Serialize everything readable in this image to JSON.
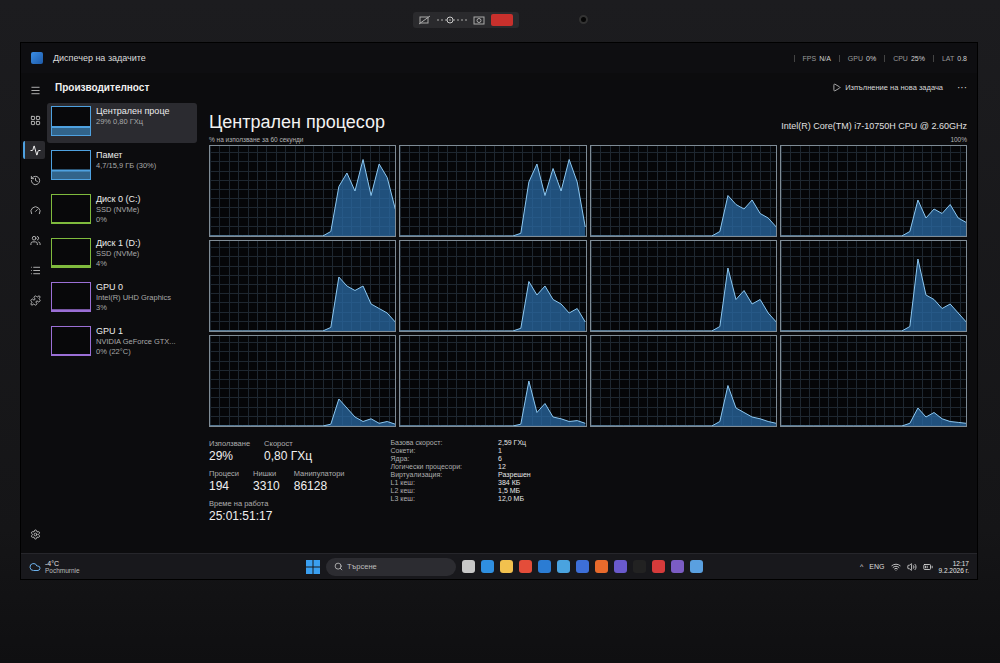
{
  "window": {
    "title": "Диспечер на задачите",
    "overlay": [
      {
        "label": "FPS",
        "value": "N/A"
      },
      {
        "label": "GPU",
        "value": "0%"
      },
      {
        "label": "CPU",
        "value": "25%"
      },
      {
        "label": "LAT",
        "value": "0.8"
      }
    ]
  },
  "nav": [
    {
      "selected": false
    },
    {
      "selected": false
    },
    {
      "selected": true
    },
    {
      "selected": false
    },
    {
      "selected": false
    },
    {
      "selected": false
    },
    {
      "selected": false
    },
    {
      "selected": false
    },
    {
      "selected": false
    }
  ],
  "header": {
    "title": "Производителност",
    "action": "Изпълнение на нова задача",
    "more": "···"
  },
  "sidebar": {
    "items": [
      {
        "name": "Централен проце",
        "lines": [
          "29% 0,80 ГХц"
        ],
        "level": 0.29,
        "color": "#4ea1e0",
        "selected": true
      },
      {
        "name": "Памет",
        "lines": [
          "4,7/15,9 ГБ (30%)"
        ],
        "level": 0.3,
        "color": "#4ea1e0",
        "selected": false
      },
      {
        "name": "Диск 0 (C:)",
        "lines": [
          "SSD (NVMe)",
          "0%"
        ],
        "level": 0.0,
        "color": "#7fba3d",
        "selected": false
      },
      {
        "name": "Диск 1 (D:)",
        "lines": [
          "SSD (NVMe)",
          "4%"
        ],
        "level": 0.04,
        "color": "#7fba3d",
        "selected": false
      },
      {
        "name": "GPU 0",
        "lines": [
          "Intel(R) UHD Graphics",
          "3%"
        ],
        "level": 0.03,
        "color": "#9b6fd6",
        "selected": false
      },
      {
        "name": "GPU 1",
        "lines": [
          "NVIDIA GeForce GTX...",
          "0% (22°C)"
        ],
        "level": 0.0,
        "color": "#9b6fd6",
        "selected": false
      }
    ]
  },
  "cpu": {
    "title": "Централен процесор",
    "model": "Intel(R) Core(TM) i7-10750H CPU @ 2.60GHz",
    "chart": {
      "caption": "% на използване за 60 секунди",
      "max": "100%",
      "series": [
        {
          "values": [
            0,
            0,
            0,
            0,
            0,
            0,
            0,
            0,
            0,
            0,
            0,
            0,
            0,
            0,
            0,
            5,
            55,
            70,
            50,
            85,
            45,
            80,
            65,
            30
          ]
        },
        {
          "values": [
            0,
            0,
            0,
            0,
            0,
            0,
            0,
            0,
            0,
            0,
            0,
            0,
            0,
            0,
            0,
            3,
            60,
            80,
            45,
            75,
            50,
            85,
            60,
            10
          ]
        },
        {
          "values": [
            0,
            0,
            0,
            0,
            0,
            0,
            0,
            0,
            0,
            0,
            0,
            0,
            0,
            0,
            0,
            0,
            5,
            45,
            35,
            30,
            40,
            25,
            20,
            10
          ]
        },
        {
          "values": [
            0,
            0,
            0,
            0,
            0,
            0,
            0,
            0,
            0,
            0,
            0,
            0,
            0,
            0,
            0,
            0,
            5,
            40,
            20,
            30,
            25,
            35,
            20,
            15
          ]
        },
        {
          "values": [
            0,
            0,
            0,
            0,
            0,
            0,
            0,
            0,
            0,
            0,
            0,
            0,
            0,
            0,
            0,
            4,
            60,
            50,
            45,
            50,
            30,
            25,
            20,
            10
          ]
        },
        {
          "values": [
            0,
            0,
            0,
            0,
            0,
            0,
            0,
            0,
            0,
            0,
            0,
            0,
            0,
            0,
            0,
            3,
            55,
            40,
            50,
            35,
            30,
            20,
            25,
            10
          ]
        },
        {
          "values": [
            0,
            0,
            0,
            0,
            0,
            0,
            0,
            0,
            0,
            0,
            0,
            0,
            0,
            0,
            0,
            0,
            5,
            70,
            35,
            45,
            30,
            35,
            20,
            10
          ]
        },
        {
          "values": [
            0,
            0,
            0,
            0,
            0,
            0,
            0,
            0,
            0,
            0,
            0,
            0,
            0,
            0,
            0,
            0,
            5,
            80,
            40,
            35,
            25,
            30,
            20,
            10
          ]
        },
        {
          "values": [
            0,
            0,
            0,
            0,
            0,
            0,
            0,
            0,
            0,
            0,
            0,
            0,
            0,
            0,
            0,
            2,
            30,
            20,
            10,
            5,
            8,
            3,
            5,
            2
          ]
        },
        {
          "values": [
            0,
            0,
            0,
            0,
            0,
            0,
            0,
            0,
            0,
            0,
            0,
            0,
            0,
            0,
            0,
            2,
            50,
            15,
            25,
            10,
            8,
            5,
            6,
            3
          ]
        },
        {
          "values": [
            0,
            0,
            0,
            0,
            0,
            0,
            0,
            0,
            0,
            0,
            0,
            0,
            0,
            0,
            0,
            0,
            5,
            45,
            20,
            15,
            10,
            8,
            5,
            3
          ]
        },
        {
          "values": [
            0,
            0,
            0,
            0,
            0,
            0,
            0,
            0,
            0,
            0,
            0,
            0,
            0,
            0,
            0,
            0,
            3,
            20,
            10,
            15,
            8,
            5,
            4,
            3
          ]
        }
      ]
    }
  },
  "stats": {
    "primary": [
      [
        {
          "label": "Използване",
          "value": "29%"
        },
        {
          "label": "Скорост",
          "value": "0,80 ГХц"
        }
      ],
      [
        {
          "label": "Процеси",
          "value": "194"
        },
        {
          "label": "Нишки",
          "value": "3310"
        },
        {
          "label": "Манипулатори",
          "value": "86128"
        }
      ],
      [
        {
          "label": "Време на работа",
          "value": "25:01:51:17"
        }
      ]
    ],
    "details": [
      {
        "label": "Базова скорост:",
        "value": "2,59 ГХц"
      },
      {
        "label": "Сокети:",
        "value": "1"
      },
      {
        "label": "Ядра:",
        "value": "6"
      },
      {
        "label": "Логически процесори:",
        "value": "12"
      },
      {
        "label": "Виртуализация:",
        "value": "Разрешен"
      },
      {
        "label": "L1 кеш:",
        "value": "384 КБ"
      },
      {
        "label": "L2 кеш:",
        "value": "1,5 МБ"
      },
      {
        "label": "L3 кеш:",
        "value": "12,0 МБ"
      }
    ]
  },
  "taskbar": {
    "weather": {
      "temp": "-4°C",
      "condition": "Pochmurnie"
    },
    "search": {
      "placeholder": "Търсене"
    },
    "tray_arrow": "^",
    "language": "ENG",
    "time": "12:17",
    "date": "9.2.2026 г."
  }
}
